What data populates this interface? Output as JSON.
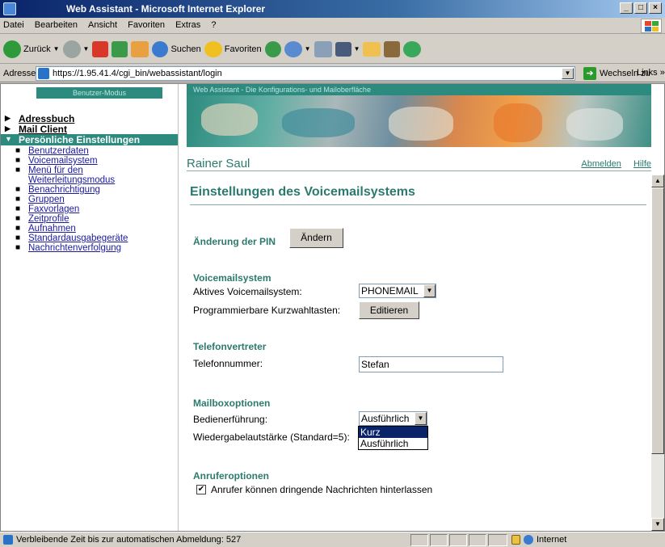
{
  "window": {
    "title": "Web Assistant - Microsoft Internet Explorer",
    "controls": [
      "_",
      "□",
      "×"
    ]
  },
  "menubar": [
    "Datei",
    "Bearbeiten",
    "Ansicht",
    "Favoriten",
    "Extras",
    "?"
  ],
  "toolbar": {
    "back": "Zurück",
    "search": "Suchen",
    "favorites": "Favoriten"
  },
  "addressbar": {
    "label": "Adresse",
    "url": "https://1.95.41.4/cgi_bin/webassistant/login",
    "go": "Wechseln zu",
    "links": "Links »"
  },
  "sidebar": {
    "mode": "Benutzer-Modus",
    "items": [
      {
        "label": "Adressbuch"
      },
      {
        "label": "Mail Client"
      },
      {
        "label": "Persönliche Einstellungen"
      }
    ],
    "subitems": [
      "Benutzerdaten",
      "Voicemailsystem",
      "Menü für den Weiterleitungsmodus",
      "Benachrichtigung",
      "Gruppen",
      "Faxvorlagen",
      "Zeitprofile",
      "Aufnahmen",
      "Standardausgabegeräte",
      "Nachrichtenverfolgung"
    ]
  },
  "banner": {
    "caption": "Web Assistant - Die Konfigurations- und Mailoberfläche"
  },
  "user": {
    "name": "Rainer Saul",
    "logout": "Abmelden",
    "help": "Hilfe"
  },
  "page": {
    "title": "Einstellungen des Voicemailsystems",
    "pin": {
      "heading": "Änderung der PIN",
      "button": "Ändern"
    },
    "voicemail": {
      "heading": "Voicemailsystem",
      "active_label": "Aktives Voicemailsystem:",
      "active_value": "PHONEMAIL",
      "speeddial_label": "Programmierbare Kurzwahltasten:",
      "edit_button": "Editieren"
    },
    "deputy": {
      "heading": "Telefonvertreter",
      "phone_label": "Telefonnummer:",
      "phone_value": "Stefan"
    },
    "mailbox": {
      "heading": "Mailboxoptionen",
      "operation_label": "Bedienerführung:",
      "operation_value": "Ausführlich",
      "options": [
        "Kurz",
        "Ausführlich"
      ],
      "volume_label": "Wiedergabelautstärke (Standard=5):"
    },
    "caller": {
      "heading": "Anruferoptionen",
      "urgent_label": "Anrufer können dringende Nachrichten hinterlassen",
      "urgent_checked": "✔"
    }
  },
  "statusbar": {
    "text": "Verbleibende Zeit bis zur automatischen Abmeldung: 527",
    "zone": "Internet"
  }
}
